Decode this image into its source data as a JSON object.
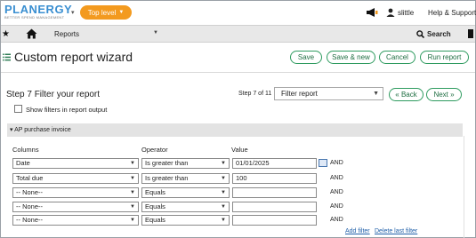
{
  "brand": {
    "name": "PLANERGY",
    "tagline": "BETTER SPEND MANAGEMENT"
  },
  "top": {
    "level_button": "Top level",
    "username": "slittle",
    "help": "Help & Support"
  },
  "nav": {
    "reports": "Reports",
    "search": "Search"
  },
  "page": {
    "title": "Custom report wizard",
    "buttons": {
      "save": "Save",
      "save_new": "Save & new",
      "cancel": "Cancel",
      "run": "Run report"
    }
  },
  "step": {
    "title": "Step 7 Filter your report",
    "show_filters_label": "Show filters in report output",
    "show_filters_checked": false,
    "indicator": "Step 7 of 11",
    "select_value": "Filter report",
    "back": "« Back",
    "next": "Next »"
  },
  "section": {
    "title": "AP purchase invoice",
    "headers": {
      "columns": "Columns",
      "operator": "Operator",
      "value": "Value"
    },
    "rows": [
      {
        "column": "Date",
        "operator": "Is greater than",
        "value": "01/01/2025",
        "has_calendar": true,
        "conj": "AND"
      },
      {
        "column": "Total due",
        "operator": "Is greater than",
        "value": "100",
        "has_calendar": false,
        "conj": "AND"
      },
      {
        "column": "-- None--",
        "operator": "Equals",
        "value": "",
        "has_calendar": false,
        "conj": "AND"
      },
      {
        "column": "-- None--",
        "operator": "Equals",
        "value": "",
        "has_calendar": false,
        "conj": "AND"
      },
      {
        "column": "-- None--",
        "operator": "Equals",
        "value": "",
        "has_calendar": false,
        "conj": "AND"
      }
    ],
    "add_filter": "Add filter",
    "delete_last_filter": "Delete last filter"
  },
  "colors": {
    "brand": "#3a8fd1",
    "accent": "#f39a1f",
    "button_border": "#2e9b5f"
  },
  "icons": [
    "megaphone-icon",
    "user-icon",
    "star-icon",
    "home-icon",
    "search-icon",
    "bookmark-icon",
    "list-icon",
    "calendar-icon",
    "caret-down-icon"
  ]
}
